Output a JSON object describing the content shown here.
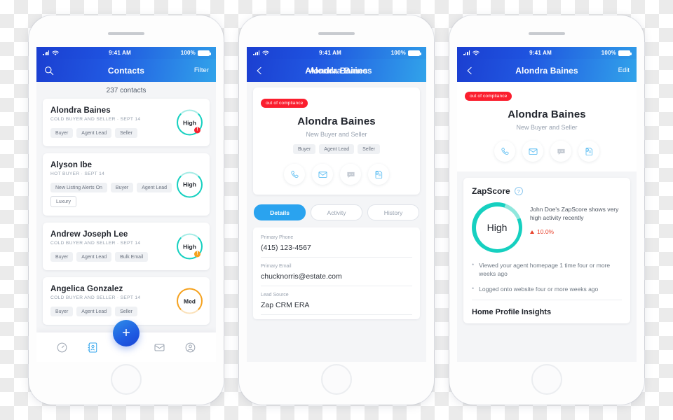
{
  "status_bar": {
    "time": "9:41 AM",
    "battery": "100%"
  },
  "phone1": {
    "nav": {
      "title": "Contacts",
      "right_action": "Filter",
      "search_icon": "search-icon"
    },
    "count": "237 contacts",
    "contacts": [
      {
        "name": "Alondra Baines",
        "meta": "COLD BUYER AND SELLER · SEPT 14",
        "chips": [
          "Buyer",
          "Agent Lead",
          "Seller"
        ],
        "score": "High",
        "score_color": "#16d0c0",
        "alert": "!",
        "alert_color": "#f5222d"
      },
      {
        "name": "Alyson Ibe",
        "meta": "HOT BUYER · SEPT 14",
        "chips": [
          "New Listing Alerts On",
          "Buyer",
          "Agent Lead",
          "Luxury"
        ],
        "score": "High",
        "score_color": "#16d0c0",
        "alert": "",
        "alert_color": ""
      },
      {
        "name": "Andrew Joseph Lee",
        "meta": "COLD BUYER AND SELLER · SEPT 14",
        "chips": [
          "Buyer",
          "Agent Lead",
          "Bulk Email"
        ],
        "score": "High",
        "score_color": "#16d0c0",
        "alert": "!",
        "alert_color": "#f5a21f"
      },
      {
        "name": "Angelica Gonzalez",
        "meta": "COLD BUYER AND SELLER · SEPT 14",
        "chips": [
          "Buyer",
          "Agent Lead",
          "Seller"
        ],
        "score": "Med",
        "score_color": "#f5a21f",
        "alert": "",
        "alert_color": ""
      }
    ],
    "tabbar": {
      "items": [
        "dashboard-icon",
        "contacts-icon",
        "mail-icon",
        "profile-icon"
      ],
      "add_label": "+"
    }
  },
  "phone2": {
    "nav": {
      "title": "Alondra Baines",
      "back_icon": "back-arrow-icon"
    },
    "compliance_badge": "out of compliance",
    "name": "Alondra Baines",
    "subtitle": "New Buyer and Seller",
    "chips": [
      "Buyer",
      "Agent Lead",
      "Seller"
    ],
    "actions": [
      "phone-icon",
      "email-icon",
      "message-icon",
      "note-icon"
    ],
    "tabs": [
      {
        "label": "Details",
        "active": true
      },
      {
        "label": "Activity",
        "active": false
      },
      {
        "label": "History",
        "active": false
      }
    ],
    "fields": [
      {
        "label": "Primary Phone",
        "value": "(415) 123-4567"
      },
      {
        "label": "Primary Email",
        "value": "chucknorris@estate.com"
      },
      {
        "label": "Lead Source",
        "value": "Zap CRM ERA"
      }
    ]
  },
  "phone3": {
    "nav": {
      "title": "Alondra Baines",
      "right_action": "Edit",
      "back_icon": "back-arrow-icon"
    },
    "compliance_badge": "out of compliance",
    "name": "Alondra Baines",
    "subtitle": "New Buyer and Seller",
    "actions": [
      "phone-icon",
      "email-icon",
      "message-icon",
      "note-icon"
    ],
    "zapscore": {
      "title": "ZapScore",
      "help_icon": "question-mark-icon",
      "ring_value": "High",
      "ring_color": "#16d0c0",
      "description": "John Doe's ZapScore shows very high activity recently",
      "delta": "10.0%",
      "delta_color": "#e8402a",
      "insights": [
        "Viewed your agent homepage 1 time four or more weeks ago",
        "Logged onto website four or more weeks ago"
      ],
      "insights_title": "Home Profile Insights"
    }
  }
}
